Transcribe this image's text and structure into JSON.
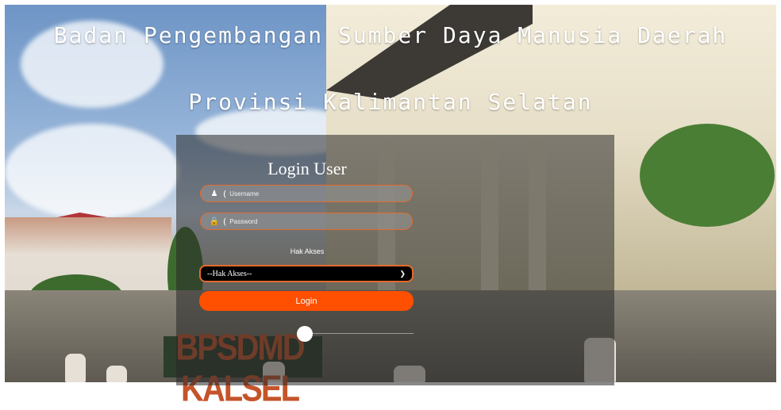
{
  "header": {
    "line1": "Badan Pengembangan Sumber Daya Manusia Daerah",
    "line2": "Provinsi Kalimantan Selatan"
  },
  "login": {
    "title": "Login User",
    "username_placeholder": "Username",
    "password_placeholder": "Password",
    "user_icon": "user-icon",
    "lock_icon": "lock-icon",
    "hak_akses_label": "Hak Akses",
    "hak_akses_selected": "--Hak Akses--",
    "login_label": "Login",
    "accent_color": "#ff4f00"
  },
  "background": {
    "banner_text": "BPSDMD KALSEL"
  }
}
